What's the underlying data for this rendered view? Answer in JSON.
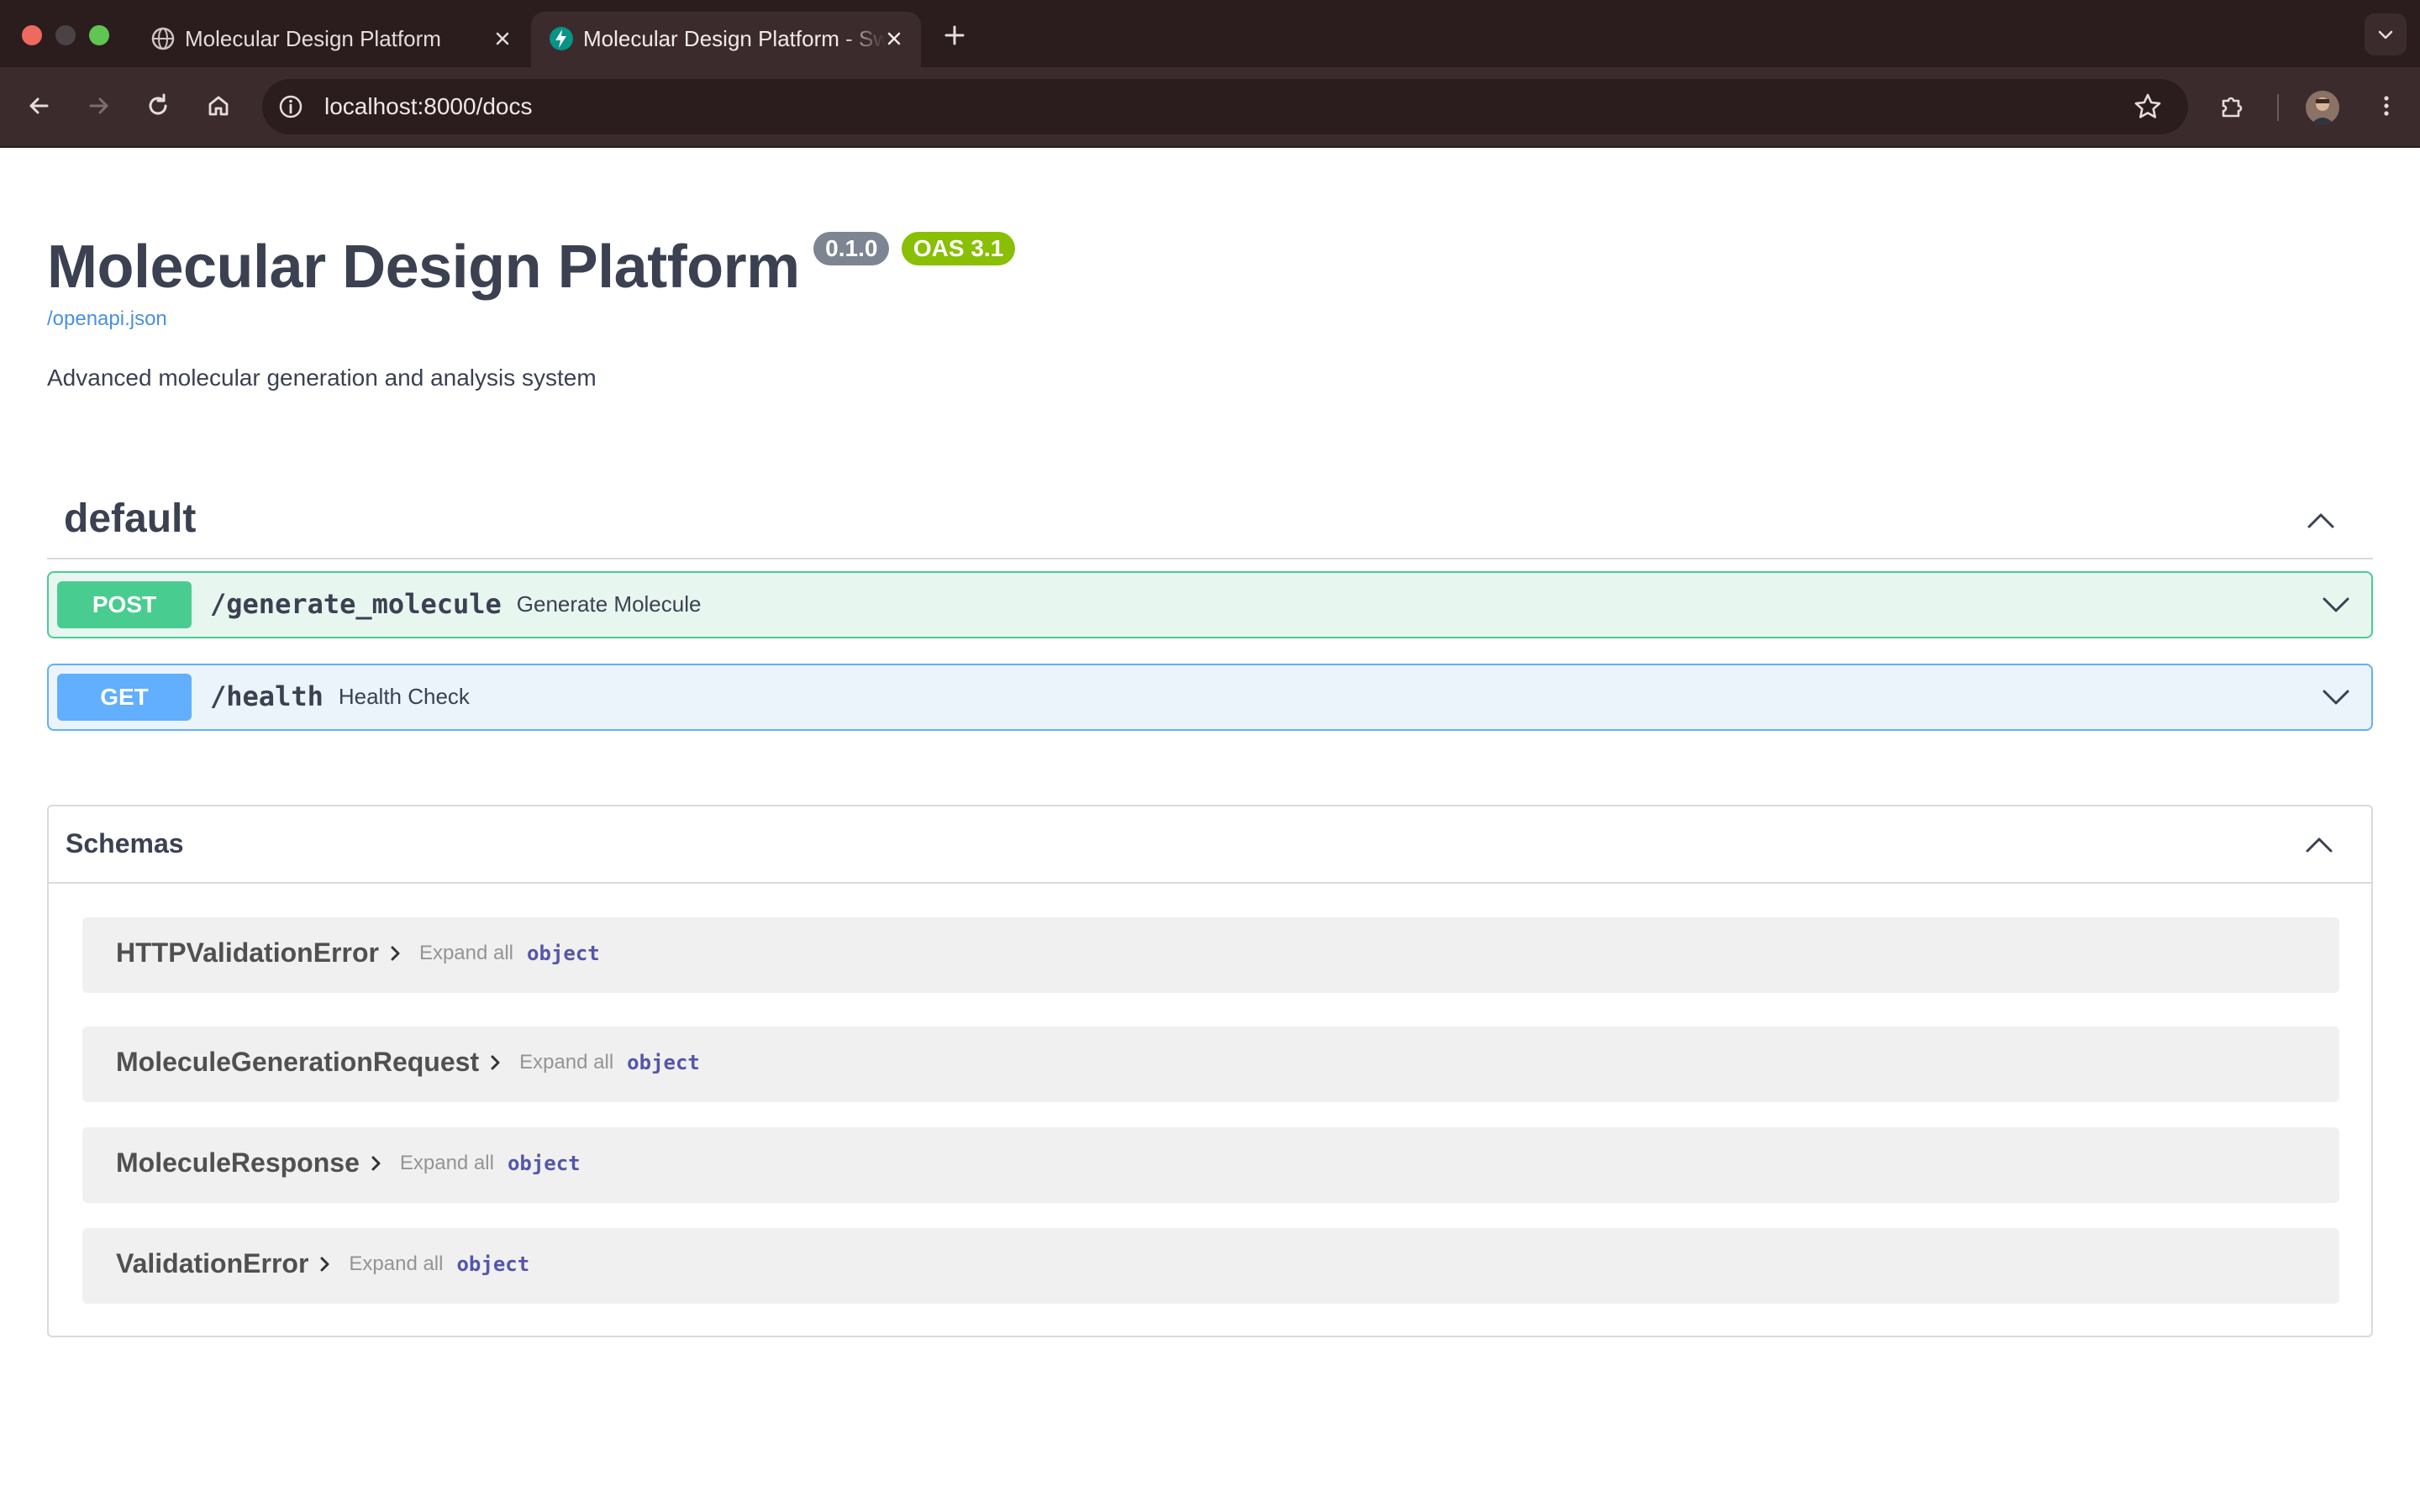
{
  "browser": {
    "tabs": [
      {
        "title": "Molecular Design Platform",
        "active": false,
        "favicon": "globe-icon"
      },
      {
        "title": "Molecular Design Platform - Swagger UI",
        "active": true,
        "favicon": "fastapi-icon"
      }
    ],
    "url": "localhost:8000/docs"
  },
  "header": {
    "title": "Molecular Design Platform",
    "version": "0.1.0",
    "oas_badge": "OAS 3.1",
    "openapi_link": "/openapi.json",
    "description": "Advanced molecular generation and analysis system"
  },
  "tag": {
    "name": "default",
    "operations": [
      {
        "method": "POST",
        "path": "/generate_molecule",
        "summary": "Generate Molecule"
      },
      {
        "method": "GET",
        "path": "/health",
        "summary": "Health Check"
      }
    ]
  },
  "schemas": {
    "title": "Schemas",
    "models": [
      {
        "name": "HTTPValidationError",
        "expand_label": "Expand all",
        "type": "object"
      },
      {
        "name": "MoleculeGenerationRequest",
        "expand_label": "Expand all",
        "type": "object"
      },
      {
        "name": "MoleculeResponse",
        "expand_label": "Expand all",
        "type": "object"
      },
      {
        "name": "ValidationError",
        "expand_label": "Expand all",
        "type": "object"
      }
    ]
  },
  "colors": {
    "post": "#49cc90",
    "get": "#61affe",
    "title": "#3b4151",
    "oas_badge": "#89bf04",
    "version_badge": "#7d8492"
  }
}
